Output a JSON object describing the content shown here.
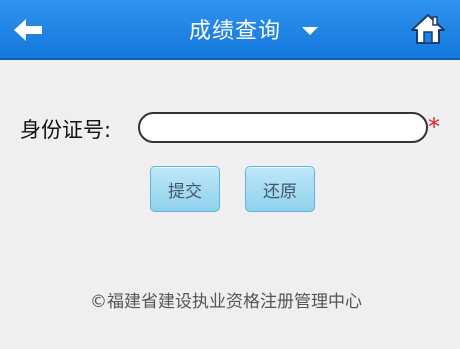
{
  "header": {
    "title": "成绩查询",
    "back_icon": "back-arrow-icon",
    "dropdown_icon": "caret-down-icon",
    "home_icon": "home-icon",
    "bg_color": "#1a82e6"
  },
  "form": {
    "id_label": "身份证号:",
    "id_value": "",
    "id_placeholder": "",
    "required_mark": "*",
    "required_color": "#e0242a"
  },
  "buttons": {
    "submit_label": "提交",
    "reset_label": "还原"
  },
  "footer": {
    "text": "©福建省建设执业资格注册管理中心"
  }
}
